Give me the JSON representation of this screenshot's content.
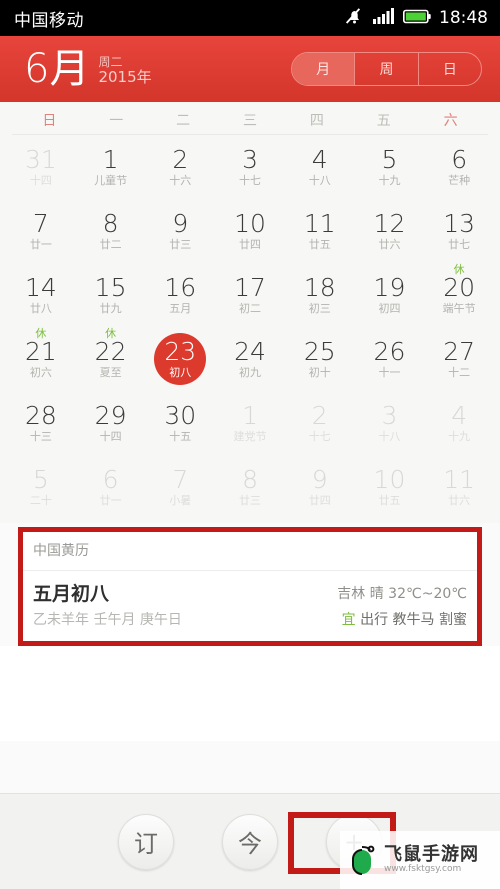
{
  "status_bar": {
    "carrier": "中国移动",
    "clock": "18:48",
    "icons": [
      "bell-muted-icon",
      "signal-bars-icon",
      "battery-icon"
    ]
  },
  "header": {
    "month": "6月",
    "weekday": "周二",
    "year": "2015年",
    "view_tabs": [
      {
        "label": "月",
        "active": true
      },
      {
        "label": "周",
        "active": false
      },
      {
        "label": "日",
        "active": false
      }
    ],
    "accent_color": "#dc3c32"
  },
  "calendar": {
    "weekday_headers": [
      {
        "label": "日",
        "weekend": true
      },
      {
        "label": "一",
        "weekend": false
      },
      {
        "label": "二",
        "weekend": false
      },
      {
        "label": "三",
        "weekend": false
      },
      {
        "label": "四",
        "weekend": false
      },
      {
        "label": "五",
        "weekend": false
      },
      {
        "label": "六",
        "weekend": true
      }
    ],
    "rest_badge": "休",
    "weeks": [
      [
        {
          "day": "31",
          "lunar": "十四",
          "out": true,
          "rest": false,
          "selected": false
        },
        {
          "day": "1",
          "lunar": "儿童节",
          "out": false,
          "rest": false,
          "selected": false
        },
        {
          "day": "2",
          "lunar": "十六",
          "out": false,
          "rest": false,
          "selected": false
        },
        {
          "day": "3",
          "lunar": "十七",
          "out": false,
          "rest": false,
          "selected": false
        },
        {
          "day": "4",
          "lunar": "十八",
          "out": false,
          "rest": false,
          "selected": false
        },
        {
          "day": "5",
          "lunar": "十九",
          "out": false,
          "rest": false,
          "selected": false
        },
        {
          "day": "6",
          "lunar": "芒种",
          "out": false,
          "rest": false,
          "selected": false
        }
      ],
      [
        {
          "day": "7",
          "lunar": "廿一",
          "out": false,
          "rest": false,
          "selected": false
        },
        {
          "day": "8",
          "lunar": "廿二",
          "out": false,
          "rest": false,
          "selected": false
        },
        {
          "day": "9",
          "lunar": "廿三",
          "out": false,
          "rest": false,
          "selected": false
        },
        {
          "day": "10",
          "lunar": "廿四",
          "out": false,
          "rest": false,
          "selected": false
        },
        {
          "day": "11",
          "lunar": "廿五",
          "out": false,
          "rest": false,
          "selected": false
        },
        {
          "day": "12",
          "lunar": "廿六",
          "out": false,
          "rest": false,
          "selected": false
        },
        {
          "day": "13",
          "lunar": "廿七",
          "out": false,
          "rest": false,
          "selected": false
        }
      ],
      [
        {
          "day": "14",
          "lunar": "廿八",
          "out": false,
          "rest": false,
          "selected": false
        },
        {
          "day": "15",
          "lunar": "廿九",
          "out": false,
          "rest": false,
          "selected": false
        },
        {
          "day": "16",
          "lunar": "五月",
          "out": false,
          "rest": false,
          "selected": false
        },
        {
          "day": "17",
          "lunar": "初二",
          "out": false,
          "rest": false,
          "selected": false
        },
        {
          "day": "18",
          "lunar": "初三",
          "out": false,
          "rest": false,
          "selected": false
        },
        {
          "day": "19",
          "lunar": "初四",
          "out": false,
          "rest": false,
          "selected": false
        },
        {
          "day": "20",
          "lunar": "端午节",
          "out": false,
          "rest": true,
          "selected": false
        }
      ],
      [
        {
          "day": "21",
          "lunar": "初六",
          "out": false,
          "rest": true,
          "selected": false
        },
        {
          "day": "22",
          "lunar": "夏至",
          "out": false,
          "rest": true,
          "selected": false
        },
        {
          "day": "23",
          "lunar": "初八",
          "out": false,
          "rest": false,
          "selected": true
        },
        {
          "day": "24",
          "lunar": "初九",
          "out": false,
          "rest": false,
          "selected": false
        },
        {
          "day": "25",
          "lunar": "初十",
          "out": false,
          "rest": false,
          "selected": false
        },
        {
          "day": "26",
          "lunar": "十一",
          "out": false,
          "rest": false,
          "selected": false
        },
        {
          "day": "27",
          "lunar": "十二",
          "out": false,
          "rest": false,
          "selected": false
        }
      ],
      [
        {
          "day": "28",
          "lunar": "十三",
          "out": false,
          "rest": false,
          "selected": false
        },
        {
          "day": "29",
          "lunar": "十四",
          "out": false,
          "rest": false,
          "selected": false
        },
        {
          "day": "30",
          "lunar": "十五",
          "out": false,
          "rest": false,
          "selected": false
        },
        {
          "day": "1",
          "lunar": "建党节",
          "out": true,
          "rest": false,
          "selected": false
        },
        {
          "day": "2",
          "lunar": "十七",
          "out": true,
          "rest": false,
          "selected": false
        },
        {
          "day": "3",
          "lunar": "十八",
          "out": true,
          "rest": false,
          "selected": false
        },
        {
          "day": "4",
          "lunar": "十九",
          "out": true,
          "rest": false,
          "selected": false
        }
      ],
      [
        {
          "day": "5",
          "lunar": "二十",
          "out": true,
          "rest": false,
          "selected": false
        },
        {
          "day": "6",
          "lunar": "廿一",
          "out": true,
          "rest": false,
          "selected": false
        },
        {
          "day": "7",
          "lunar": "小暑",
          "out": true,
          "rest": false,
          "selected": false
        },
        {
          "day": "8",
          "lunar": "廿三",
          "out": true,
          "rest": false,
          "selected": false
        },
        {
          "day": "9",
          "lunar": "廿四",
          "out": true,
          "rest": false,
          "selected": false
        },
        {
          "day": "10",
          "lunar": "廿五",
          "out": true,
          "rest": false,
          "selected": false
        },
        {
          "day": "11",
          "lunar": "廿六",
          "out": true,
          "rest": false,
          "selected": false
        }
      ]
    ]
  },
  "detail_card": {
    "title": "中国黄历",
    "lunar_date": "五月初八",
    "ganzhi": "乙未羊年 壬午月 庚午日",
    "weather": "吉林 晴 32℃~20℃",
    "yi_label": "宜",
    "yi_items": "出行 教牛马 割蜜",
    "highlight_color": "#c21a17"
  },
  "toolbar": {
    "buttons": [
      {
        "label": "订",
        "name": "subscribe-button"
      },
      {
        "label": "今",
        "name": "today-button"
      },
      {
        "label": "+",
        "name": "add-event-button"
      }
    ]
  },
  "watermark": {
    "name": "飞鼠手游网",
    "url": "www.fsktgsy.com"
  }
}
